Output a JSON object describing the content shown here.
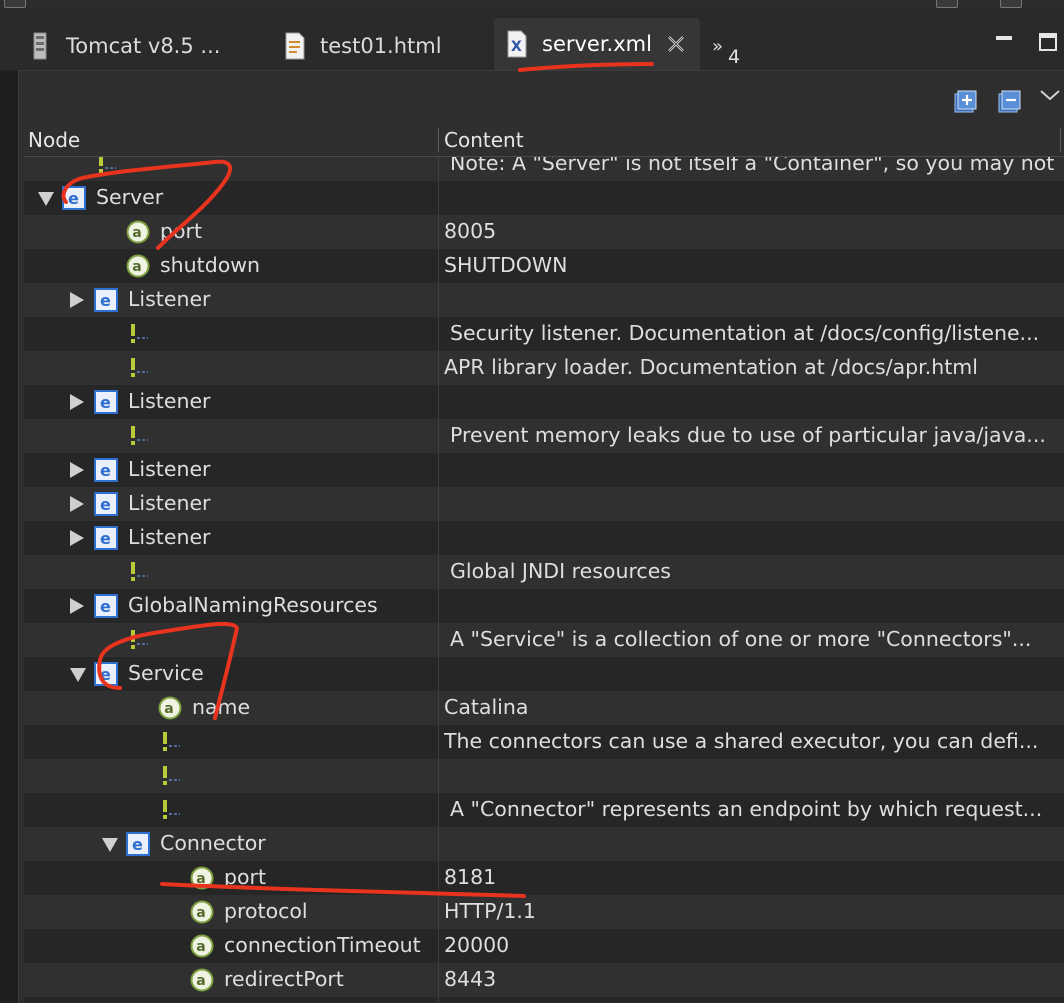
{
  "tabs": [
    {
      "label": "Tomcat v8.5 ...",
      "icon": "server-config-icon"
    },
    {
      "label": "test01.html",
      "icon": "html-file-icon"
    },
    {
      "label": "server.xml",
      "icon": "xml-file-icon",
      "active": true
    }
  ],
  "overflow": {
    "chevron": "»",
    "count": "4"
  },
  "columns": {
    "node": "Node",
    "content": "Content"
  },
  "rows": [
    {
      "kind": "comment",
      "depth": 1,
      "label": "",
      "content": "Note:  A \"Server\" is not itself a \"Container\", so you may not",
      "indent": true
    },
    {
      "kind": "element",
      "depth": 0,
      "label": "Server",
      "content": "",
      "twisty": "open"
    },
    {
      "kind": "attribute",
      "depth": 2,
      "label": "port",
      "content": "8005"
    },
    {
      "kind": "attribute",
      "depth": 2,
      "label": "shutdown",
      "content": "SHUTDOWN"
    },
    {
      "kind": "element",
      "depth": 1,
      "label": "Listener",
      "content": "",
      "twisty": "closed"
    },
    {
      "kind": "comment",
      "depth": 2,
      "label": "",
      "content": "Security listener. Documentation at /docs/config/listene...",
      "indent": true
    },
    {
      "kind": "comment",
      "depth": 2,
      "label": "",
      "content": "APR library loader. Documentation at /docs/apr.html"
    },
    {
      "kind": "element",
      "depth": 1,
      "label": "Listener",
      "content": "",
      "twisty": "closed"
    },
    {
      "kind": "comment",
      "depth": 2,
      "label": "",
      "content": "Prevent memory leaks due to use of particular java/java...",
      "indent": true
    },
    {
      "kind": "element",
      "depth": 1,
      "label": "Listener",
      "content": "",
      "twisty": "closed"
    },
    {
      "kind": "element",
      "depth": 1,
      "label": "Listener",
      "content": "",
      "twisty": "closed"
    },
    {
      "kind": "element",
      "depth": 1,
      "label": "Listener",
      "content": "",
      "twisty": "closed"
    },
    {
      "kind": "comment",
      "depth": 2,
      "label": "",
      "content": "Global JNDI resources",
      "indent": true
    },
    {
      "kind": "element",
      "depth": 1,
      "label": "GlobalNamingResources",
      "content": "",
      "twisty": "closed"
    },
    {
      "kind": "comment",
      "depth": 2,
      "label": "",
      "content": "A \"Service\" is a collection of one or more \"Connectors\"...",
      "indent": true
    },
    {
      "kind": "element",
      "depth": 1,
      "label": "Service",
      "content": "",
      "twisty": "open"
    },
    {
      "kind": "attribute",
      "depth": 3,
      "label": "name",
      "content": "Catalina"
    },
    {
      "kind": "comment",
      "depth": 3,
      "label": "",
      "content": "The connectors can use a shared executor, you can defi..."
    },
    {
      "kind": "comment",
      "depth": 3,
      "label": "",
      "content": ""
    },
    {
      "kind": "comment",
      "depth": 3,
      "label": "",
      "content": "A \"Connector\" represents an endpoint by which request...",
      "indent": true
    },
    {
      "kind": "element",
      "depth": 2,
      "label": "Connector",
      "content": "",
      "twisty": "open"
    },
    {
      "kind": "attribute",
      "depth": 4,
      "label": "port",
      "content": "8181"
    },
    {
      "kind": "attribute",
      "depth": 4,
      "label": "protocol",
      "content": "HTTP/1.1"
    },
    {
      "kind": "attribute",
      "depth": 4,
      "label": "connectionTimeout",
      "content": "20000"
    },
    {
      "kind": "attribute",
      "depth": 4,
      "label": "redirectPort",
      "content": "8443"
    },
    {
      "kind": "comment",
      "depth": 3,
      "label": "",
      "content": ""
    }
  ],
  "colors": {
    "annotation": "#e8331f",
    "element_icon": "#2f6fd0",
    "attribute_icon": "#7fa040",
    "comment_icon": "#b8c93a"
  }
}
